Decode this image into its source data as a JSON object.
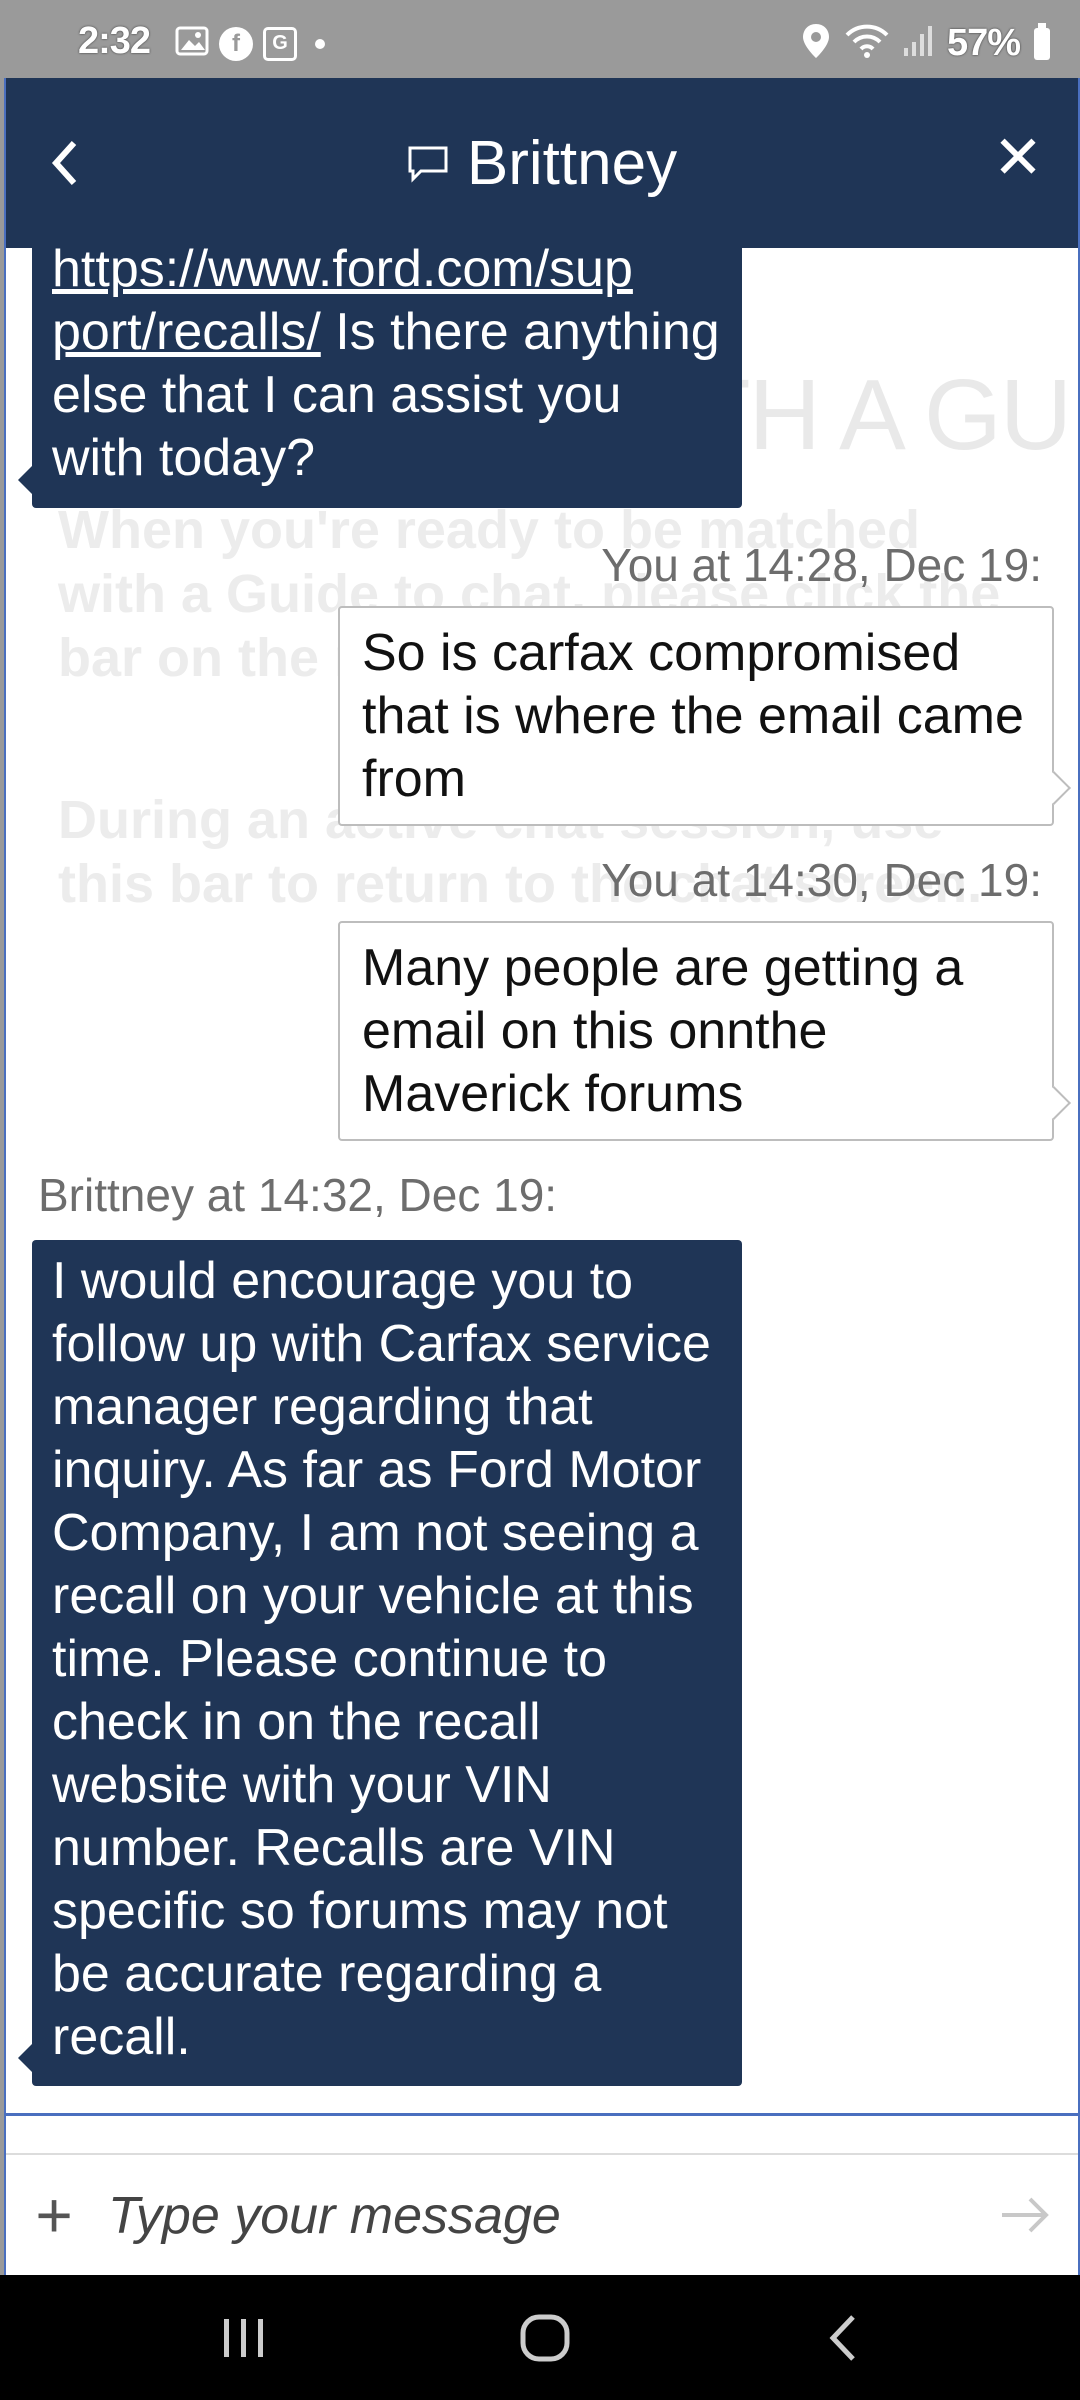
{
  "status_bar": {
    "time": "2:32",
    "notification_icons": [
      "image-icon",
      "facebook-icon",
      "g-app-icon",
      "dot-icon"
    ],
    "g_label": "G",
    "f_label": "f",
    "battery_percent": "57%",
    "right_icons": [
      "location-icon",
      "wifi-icon",
      "signal-icon",
      "battery-icon"
    ]
  },
  "header": {
    "title": "Brittney",
    "icon": "chat-bubble-icon",
    "back_icon": "back-chevron-icon",
    "close_icon": "close-icon",
    "close_glyph": "✕"
  },
  "background_overlay": {
    "heading": "LIVE CHAT WITH A GUIDE",
    "line1": "When you're ready to be matched with a Guide to chat, please click the bar on the right:",
    "line2": "During an active chat session, use this bar to return to the chat screen."
  },
  "messages": [
    {
      "sender": "agent",
      "link_text": "https://www.ford.com/sup port/recalls/",
      "text": " Is there anything else that I can assist you with today?"
    },
    {
      "sender": "user",
      "meta": "You at 14:28, Dec 19:",
      "text": "So is carfax compromised that is where the email came from"
    },
    {
      "sender": "user",
      "meta": "You at 14:30, Dec 19:",
      "text": "Many people are getting a email on this onnthe Maverick forums"
    },
    {
      "sender": "agent",
      "meta": "Brittney at 14:32, Dec 19:",
      "text": "I would encourage you to follow up with Carfax service manager regarding that inquiry. As far as Ford Motor Company, I am not seeing a recall on your vehicle at this time. Please continue to check in on the recall website with your VIN number. Recalls are VIN specific so forums may not be accurate regarding a recall."
    }
  ],
  "input": {
    "placeholder": "Type your message",
    "value": "",
    "plus_label": "+",
    "send_icon": "send-arrow-icon"
  },
  "nav_bar": {
    "buttons": [
      "recent-apps-icon",
      "home-icon",
      "back-icon"
    ]
  },
  "colors": {
    "header_bg": "#1f3556",
    "agent_bubble": "#1f3556",
    "status_bar_bg": "#9a9a9a",
    "accent_border": "#4a6fbf"
  }
}
